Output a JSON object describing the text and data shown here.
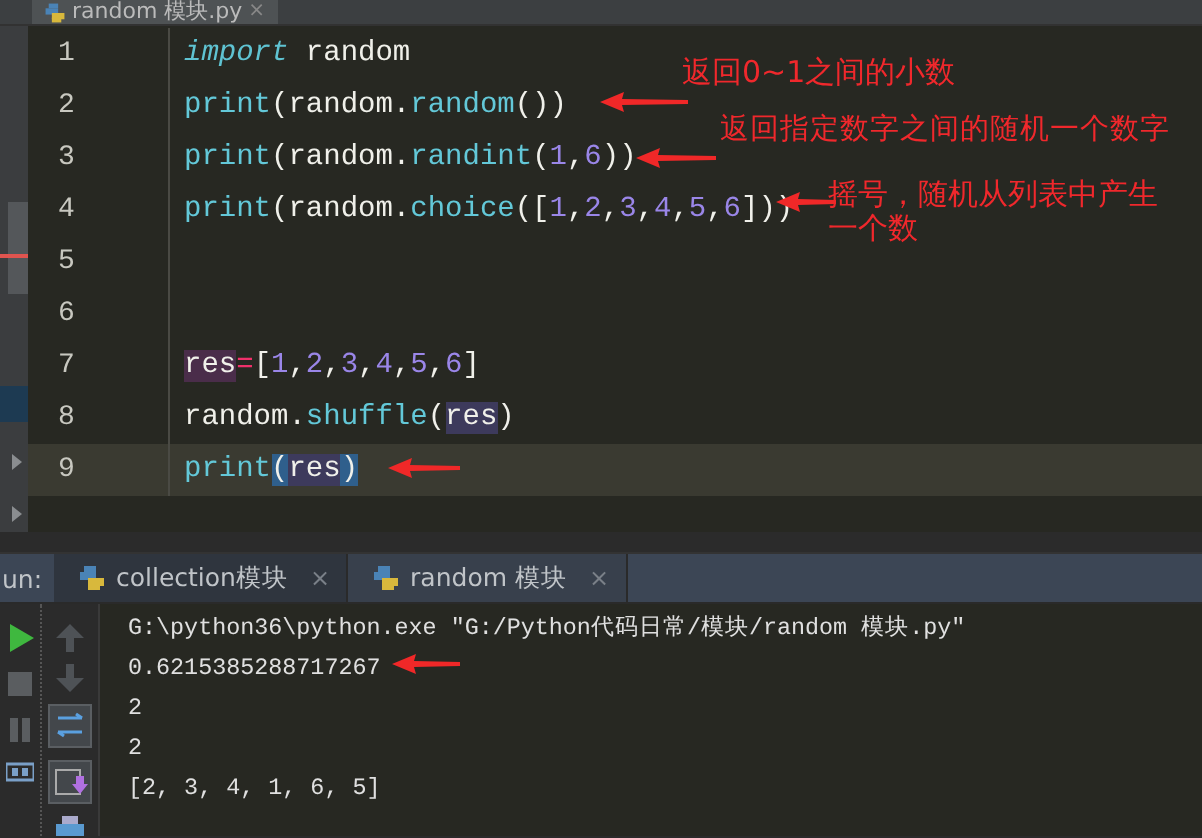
{
  "editor_tab": {
    "label": "random 模块.py",
    "close": "×"
  },
  "code_lines": [
    {
      "number": "1",
      "current": false,
      "tokens": [
        {
          "text": "import",
          "kind": "keyword"
        },
        {
          "text": " random",
          "kind": "plain"
        }
      ]
    },
    {
      "number": "2",
      "current": false,
      "tokens": [
        {
          "text": "print",
          "kind": "call"
        },
        {
          "text": "(random.",
          "kind": "plain"
        },
        {
          "text": "random",
          "kind": "call"
        },
        {
          "text": "())",
          "kind": "plain"
        }
      ]
    },
    {
      "number": "3",
      "current": false,
      "tokens": [
        {
          "text": "print",
          "kind": "call"
        },
        {
          "text": "(random.",
          "kind": "plain"
        },
        {
          "text": "randint",
          "kind": "call"
        },
        {
          "text": "(",
          "kind": "plain"
        },
        {
          "text": "1",
          "kind": "number"
        },
        {
          "text": ",",
          "kind": "plain"
        },
        {
          "text": "6",
          "kind": "number"
        },
        {
          "text": "))",
          "kind": "plain"
        }
      ]
    },
    {
      "number": "4",
      "current": false,
      "tokens": [
        {
          "text": "print",
          "kind": "call"
        },
        {
          "text": "(random.",
          "kind": "plain"
        },
        {
          "text": "choice",
          "kind": "call"
        },
        {
          "text": "([",
          "kind": "plain"
        },
        {
          "text": "1",
          "kind": "number"
        },
        {
          "text": ",",
          "kind": "plain"
        },
        {
          "text": "2",
          "kind": "number"
        },
        {
          "text": ",",
          "kind": "plain"
        },
        {
          "text": "3",
          "kind": "number"
        },
        {
          "text": ",",
          "kind": "plain"
        },
        {
          "text": "4",
          "kind": "number"
        },
        {
          "text": ",",
          "kind": "plain"
        },
        {
          "text": "5",
          "kind": "number"
        },
        {
          "text": ",",
          "kind": "plain"
        },
        {
          "text": "6",
          "kind": "number"
        },
        {
          "text": "]))",
          "kind": "plain"
        }
      ]
    },
    {
      "number": "5",
      "current": false
    },
    {
      "number": "6",
      "current": false
    },
    {
      "number": "7",
      "current": false,
      "tokens": [
        {
          "text": "res",
          "kind": "write"
        },
        {
          "text": "=",
          "kind": "operator"
        },
        {
          "text": "[",
          "kind": "plain"
        },
        {
          "text": "1",
          "kind": "number"
        },
        {
          "text": ",",
          "kind": "plain"
        },
        {
          "text": "2",
          "kind": "number"
        },
        {
          "text": ",",
          "kind": "plain"
        },
        {
          "text": "3",
          "kind": "number"
        },
        {
          "text": ",",
          "kind": "plain"
        },
        {
          "text": "4",
          "kind": "number"
        },
        {
          "text": ",",
          "kind": "plain"
        },
        {
          "text": "5",
          "kind": "number"
        },
        {
          "text": ",",
          "kind": "plain"
        },
        {
          "text": "6",
          "kind": "number"
        },
        {
          "text": "]",
          "kind": "plain"
        }
      ]
    },
    {
      "number": "8",
      "current": false,
      "tokens": [
        {
          "text": "random.",
          "kind": "plain"
        },
        {
          "text": "shuffle",
          "kind": "call"
        },
        {
          "text": "(",
          "kind": "plain"
        },
        {
          "text": "res",
          "kind": "read"
        },
        {
          "text": ")",
          "kind": "plain"
        }
      ]
    },
    {
      "number": "9",
      "current": true,
      "tokens": [
        {
          "text": "print",
          "kind": "call"
        },
        {
          "text": "(",
          "kind": "brace"
        },
        {
          "text": "res",
          "kind": "read"
        },
        {
          "text": ")",
          "kind": "brace"
        }
      ]
    }
  ],
  "annotations": [
    {
      "text": "返回0~1之间的小数"
    },
    {
      "text": "返回指定数字之间的随机一个数字"
    },
    {
      "text": "摇号，随机从列表中产生一个数"
    }
  ],
  "run_panel": {
    "label": "un:",
    "tabs": [
      {
        "label": "collection模块",
        "selected": false,
        "close": "×"
      },
      {
        "label": "random 模块",
        "selected": true,
        "close": "×"
      }
    ],
    "output": [
      "G:\\python36\\python.exe \"G:/Python代码日常/模块/random 模块.py\"",
      "0.6215385288717267",
      "2",
      "2",
      "[2, 3, 4, 1, 6, 5]"
    ]
  }
}
